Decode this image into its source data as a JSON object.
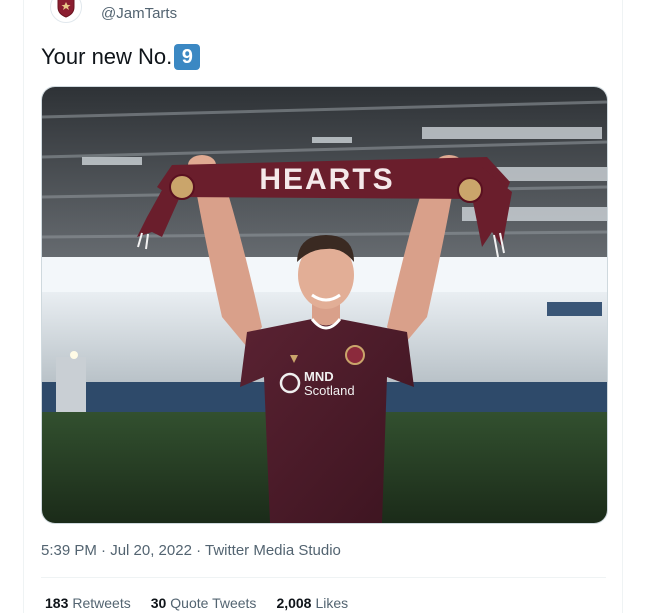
{
  "tweet": {
    "handle": "@JamTarts",
    "text": "Your new No.",
    "emoji_number": "9",
    "scarf_text": "HEARTS",
    "shirt_sponsor_line1": "MND",
    "shirt_sponsor_line2": "Scotland",
    "timestamp": "5:39 PM · Jul 20, 2022",
    "separator": " · ",
    "source": "Twitter Media Studio"
  },
  "stats": {
    "retweets_count": "183",
    "retweets_label": "Retweets",
    "quotes_count": "30",
    "quotes_label": "Quote Tweets",
    "likes_count": "2,008",
    "likes_label": "Likes"
  },
  "colors": {
    "maroon": "#6a1e2c",
    "keycap": "#3b88c3",
    "muted_text": "#536471"
  },
  "icons": {
    "avatar": "hearts-crest-icon",
    "keycap": "keycap-digit-icon"
  }
}
